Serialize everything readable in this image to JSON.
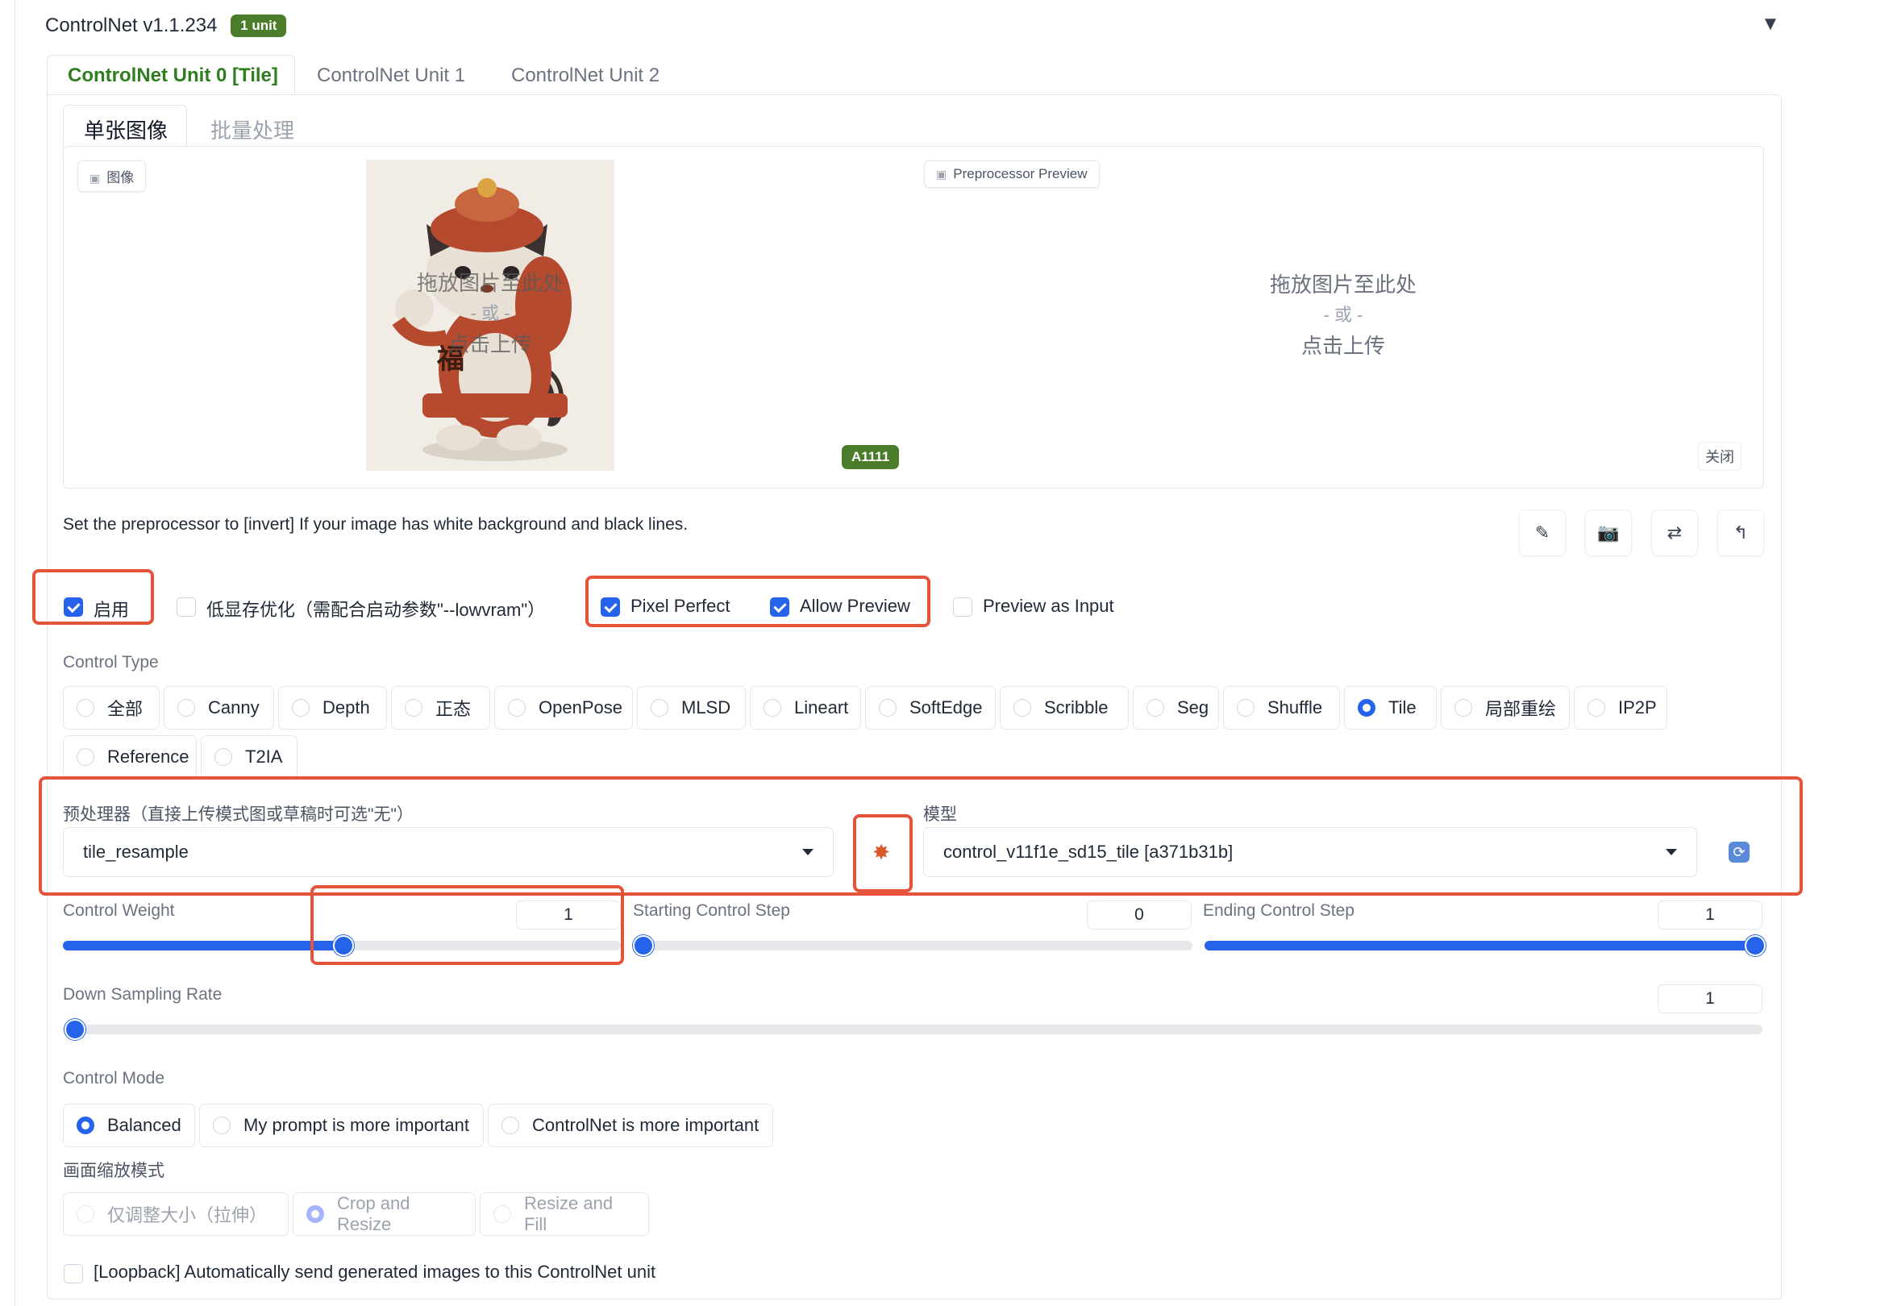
{
  "header": {
    "title": "ControlNet v1.1.234",
    "badge": "1 unit",
    "collapse_icon": "triangle-down-icon"
  },
  "unit_tabs": [
    {
      "label": "ControlNet Unit 0 [Tile]",
      "active": true
    },
    {
      "label": "ControlNet Unit 1",
      "active": false
    },
    {
      "label": "ControlNet Unit 2",
      "active": false
    }
  ],
  "image_tabs": [
    {
      "label": "单张图像",
      "active": true
    },
    {
      "label": "批量处理",
      "active": false
    }
  ],
  "image_panel": {
    "image_label": "图像",
    "preview_label": "Preprocessor Preview",
    "drop_line1": "拖放图片至此处",
    "drop_or": "- 或 -",
    "drop_line2": "点击上传",
    "canvas_badge": "A1111",
    "close_label": "关闭",
    "sample_char": "福"
  },
  "hint": "Set the preprocessor to [invert] If your image has white background and black lines.",
  "toolbar": [
    {
      "icon": "edit-icon",
      "glyph": "✎"
    },
    {
      "icon": "camera-icon",
      "glyph": "📷"
    },
    {
      "icon": "swap-icon",
      "glyph": "⇄"
    },
    {
      "icon": "send-up-icon",
      "glyph": "↰"
    }
  ],
  "options": {
    "enable": {
      "label": "启用",
      "checked": true
    },
    "lowvram": {
      "label": "低显存优化（需配合启动参数\"--lowvram\"）",
      "checked": false
    },
    "pixel_perfect": {
      "label": "Pixel Perfect",
      "checked": true
    },
    "allow_preview": {
      "label": "Allow Preview",
      "checked": true
    },
    "preview_as_input": {
      "label": "Preview as Input",
      "checked": false
    }
  },
  "control_type": {
    "label": "Control Type",
    "options": [
      "全部",
      "Canny",
      "Depth",
      "正态",
      "OpenPose",
      "MLSD",
      "Lineart",
      "SoftEdge",
      "Scribble",
      "Seg",
      "Shuffle",
      "Tile",
      "局部重绘",
      "IP2P",
      "Reference",
      "T2IA"
    ],
    "selected": "Tile"
  },
  "preprocessor": {
    "label": "预处理器（直接上传模式图或草稿时可选\"无\"）",
    "value": "tile_resample",
    "run_icon": "explosion-icon"
  },
  "model": {
    "label": "模型",
    "value": "control_v11f1e_sd15_tile [a371b31b]",
    "refresh_icon": "refresh-icon"
  },
  "sliders": {
    "control_weight": {
      "label": "Control Weight",
      "value": "1",
      "fraction": 0.5
    },
    "starting_step": {
      "label": "Starting Control Step",
      "value": "0",
      "fraction": 0.0
    },
    "ending_step": {
      "label": "Ending Control Step",
      "value": "1",
      "fraction": 1.0
    },
    "down_sampling": {
      "label": "Down Sampling Rate",
      "value": "1",
      "fraction": 0.0
    }
  },
  "control_mode": {
    "label": "Control Mode",
    "options": [
      "Balanced",
      "My prompt is more important",
      "ControlNet is more important"
    ],
    "selected": "Balanced"
  },
  "resize_mode": {
    "label": "画面缩放模式",
    "options": [
      "仅调整大小（拉伸）",
      "Crop and Resize",
      "Resize and Fill"
    ],
    "selected": "Crop and Resize"
  },
  "loopback": {
    "label": "[Loopback] Automatically send generated images to this ControlNet unit",
    "checked": false
  },
  "colors": {
    "accent": "#2563eb",
    "highlight": "#e5533a",
    "tab_active": "#2e7d1e",
    "badge": "#4a7c2a"
  }
}
